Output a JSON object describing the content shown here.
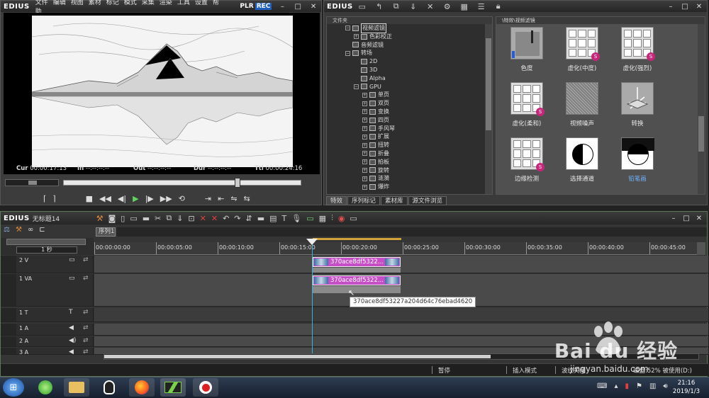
{
  "player": {
    "logo": "EDIUS",
    "menu": [
      "文件",
      "编辑",
      "视图",
      "素材",
      "标记",
      "模式",
      "采集",
      "渲染",
      "工具",
      "设置",
      "帮助"
    ],
    "plr": "PLR",
    "rec": "REC",
    "cur_label": "Cur",
    "cur": "00:00:17:13",
    "in_label": "In",
    "in": "--:--:--:--",
    "out_label": "Out",
    "out": "--:--:--:--",
    "dur_label": "Dur",
    "dur": "--:--:--:--",
    "ttl_label": "Ttl",
    "ttl": "00:00:24:16",
    "scrub_position": 0.73
  },
  "effects": {
    "logo": "EDIUS",
    "tree_header": "文件夹",
    "path": "\\特效\\视频滤镜",
    "tree": [
      {
        "label": "视频滤镜",
        "indent": 1,
        "box": "⊟",
        "selected": true
      },
      {
        "label": "色彩校正",
        "indent": 2,
        "box": "⊞"
      },
      {
        "label": "音频滤镜",
        "indent": 1,
        "box": ""
      },
      {
        "label": "转场",
        "indent": 1,
        "box": "⊟"
      },
      {
        "label": "2D",
        "indent": 2,
        "box": ""
      },
      {
        "label": "3D",
        "indent": 2,
        "box": ""
      },
      {
        "label": "Alpha",
        "indent": 2,
        "box": ""
      },
      {
        "label": "GPU",
        "indent": 2,
        "box": "⊟"
      },
      {
        "label": "单页",
        "indent": 3,
        "box": "⊞"
      },
      {
        "label": "双页",
        "indent": 3,
        "box": "⊞"
      },
      {
        "label": "变换",
        "indent": 3,
        "box": "⊞"
      },
      {
        "label": "四页",
        "indent": 3,
        "box": "⊞"
      },
      {
        "label": "手风琴",
        "indent": 3,
        "box": "⊞"
      },
      {
        "label": "扩展",
        "indent": 3,
        "box": "⊞"
      },
      {
        "label": "扭转",
        "indent": 3,
        "box": "⊞"
      },
      {
        "label": "折叠",
        "indent": 3,
        "box": "⊞"
      },
      {
        "label": "拍板",
        "indent": 3,
        "box": "⊞"
      },
      {
        "label": "旋转",
        "indent": 3,
        "box": "⊞"
      },
      {
        "label": "涟漪",
        "indent": 3,
        "box": "⊞"
      },
      {
        "label": "爆炸",
        "indent": 3,
        "box": "⊞"
      }
    ],
    "items": [
      {
        "label": "色度",
        "kind": "chroma"
      },
      {
        "label": "虚化(中度)",
        "kind": "grid",
        "badge": "S"
      },
      {
        "label": "虚化(强烈)",
        "kind": "grid",
        "badge": "S"
      },
      {
        "label": "虚化(柔和)",
        "kind": "grid",
        "badge": "S"
      },
      {
        "label": "视频噪声",
        "kind": "noise"
      },
      {
        "label": "转换",
        "kind": "transform"
      },
      {
        "label": "边缘检测",
        "kind": "grid",
        "badge": "S"
      },
      {
        "label": "选择通道",
        "kind": "channel"
      },
      {
        "label": "铅笔画",
        "kind": "pencil",
        "highlight": true
      }
    ],
    "tabs": [
      "特效",
      "序列标记",
      "素材库",
      "源文件浏览"
    ]
  },
  "timeline": {
    "logo": "EDIUS",
    "project": "无标题14",
    "sequence_tab": "序列1",
    "scale": "1 秒",
    "ruler": [
      "00:00:00:00",
      "00:00:05:00",
      "00:00:10:00",
      "00:00:15:00",
      "00:00:20:00",
      "00:00:25:00",
      "00:00:30:00",
      "00:00:35:00",
      "00:00:40:00",
      "00:00:45:00"
    ],
    "tracks": [
      {
        "name": "2 V"
      },
      {
        "name": "1 VA"
      },
      {
        "name": "1 T"
      },
      {
        "name": "1 A"
      },
      {
        "name": "2 A"
      },
      {
        "name": "3 A"
      }
    ],
    "clip_label": "370ace8df5322...",
    "tooltip": "370ace8df53227a204d64c76ebad4620"
  },
  "status": {
    "pause": "暂停",
    "mode": "插入模式",
    "ripple": "波纹关闭",
    "disk": "磁盘:52% 被使用(D:)"
  },
  "taskbar": {
    "time": "21:16",
    "date": "2019/1/3"
  },
  "watermark": {
    "brand": "Bai du 经验",
    "url": "jingyan.baidu.com"
  }
}
